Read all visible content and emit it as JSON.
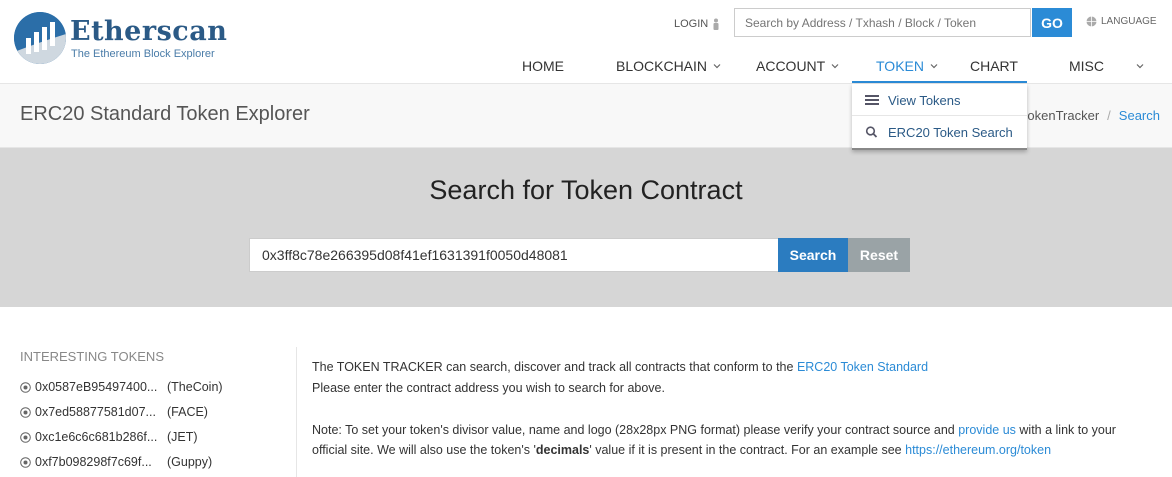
{
  "header": {
    "logo_title": "Etherscan",
    "logo_subtitle": "The Ethereum Block Explorer",
    "login_label": "LOGIN",
    "search_placeholder": "Search by Address / Txhash / Block / Token",
    "go_label": "GO",
    "language_label": "LANGUAGE"
  },
  "nav": {
    "items": [
      {
        "label": "HOME"
      },
      {
        "label": "BLOCKCHAIN"
      },
      {
        "label": "ACCOUNT"
      },
      {
        "label": "TOKEN"
      },
      {
        "label": "CHART"
      },
      {
        "label": "MISC"
      }
    ]
  },
  "dropdown": {
    "items": [
      {
        "label": "View Tokens",
        "icon": "list-icon"
      },
      {
        "label": "ERC20 Token Search",
        "icon": "search-icon"
      }
    ]
  },
  "page": {
    "title": "ERC20 Standard Token Explorer",
    "breadcrumb": [
      "okenTracker",
      "Search"
    ]
  },
  "search_panel": {
    "title": "Search for Token Contract",
    "input_value": "0x3ff8c78e266395d08f41ef1631391f0050d48081",
    "search_label": "Search",
    "reset_label": "Reset"
  },
  "interesting": {
    "title": "INTERESTING TOKENS",
    "tokens": [
      {
        "address": "0x0587eB95497400...",
        "name": "(TheCoin)"
      },
      {
        "address": "0x7ed58877581d07...",
        "name": "(FACE)"
      },
      {
        "address": "0xc1e6c6c681b286f...",
        "name": "(JET)"
      },
      {
        "address": "0xf7b098298f7c69f...",
        "name": "(Guppy)"
      }
    ]
  },
  "info": {
    "line1_text": "The TOKEN TRACKER can search, discover and track all contracts that conform to the ",
    "line1_link": "ERC20 Token Standard",
    "line2": "Please enter the contract address you wish to search for above.",
    "note_text": "Note: To set your token's divisor value, name and logo (28x28px PNG format) please verify your contract source and ",
    "note_link": "provide us",
    "note_text2": " with a link to your",
    "note_line2_a": "official site. We will also use the token's '",
    "note_bold": "decimals",
    "note_line2_b": "' value if it is present in the contract. For an example see ",
    "note_link2": "https://ethereum.org/token"
  },
  "colors": {
    "accent": "#2b8bd6",
    "hero_bg": "#d6d6d6",
    "reset_bg": "#9aa3a6"
  }
}
